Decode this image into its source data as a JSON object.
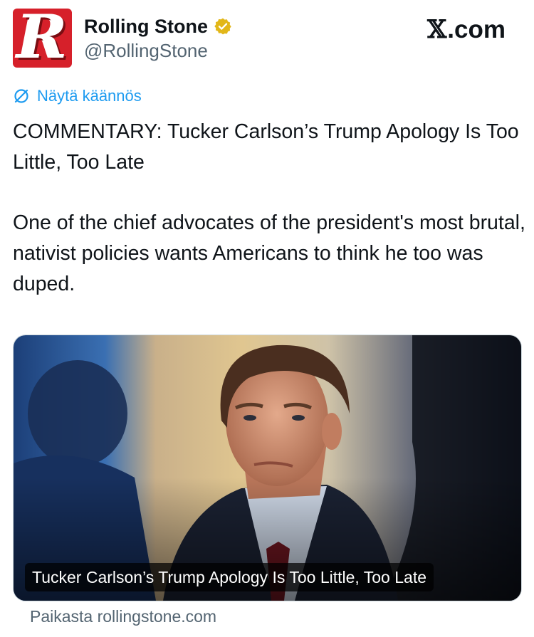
{
  "header": {
    "avatar_letter": "R",
    "display_name": "Rolling Stone",
    "handle": "@RollingStone",
    "site_label": ".com",
    "site_glyph": "𝕏"
  },
  "translate": {
    "label": "Näytä käännös"
  },
  "tweet": {
    "text_1": "COMMENTARY: Tucker Carlson’s Trump Apology Is Too Little, Too Late",
    "text_2": "One of the chief advocates of the president's most brutal, nativist policies wants Americans to think he too was duped."
  },
  "card": {
    "caption": "Tucker Carlson’s Trump Apology Is Too Little, Too Late"
  },
  "source": {
    "label": "Paikasta rollingstone.com"
  },
  "colors": {
    "link": "#1d9bf0",
    "secondary_text": "#536471",
    "brand_red": "#d6202a",
    "verified_gold": "#e2b719"
  },
  "icons": {
    "verified": "verified-gold-badge-icon",
    "translate": "translate-slash-icon"
  }
}
